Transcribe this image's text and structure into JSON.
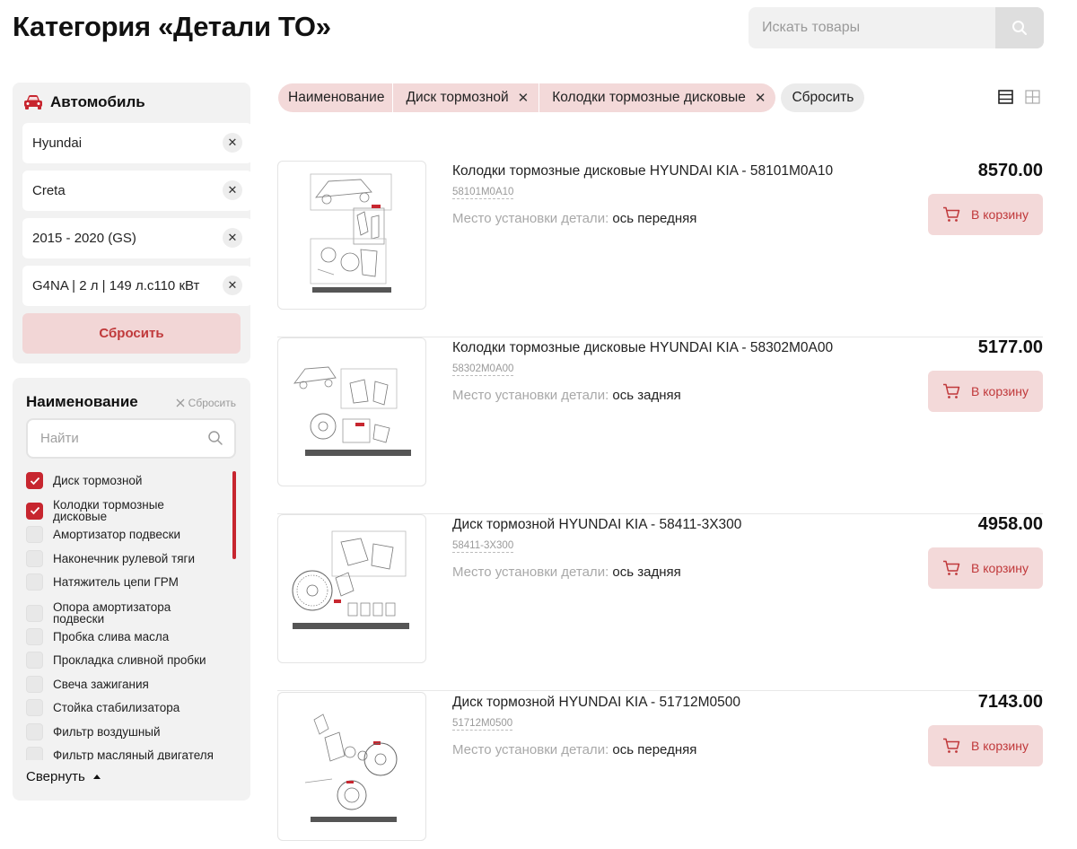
{
  "page": {
    "title": "Категория «Детали ТО»"
  },
  "search": {
    "placeholder": "Искать товары"
  },
  "car": {
    "title": "Автомобиль",
    "fields": [
      "Hyundai",
      "Creta",
      "2015 - 2020 (GS)",
      "G4NA | 2 л | 149 л.с110 кВт"
    ],
    "reset_label": "Сбросить"
  },
  "name_filter": {
    "title": "Наименование",
    "reset_label": "Сбросить",
    "search_placeholder": "Найти",
    "options": [
      {
        "label": "Диск тормозной",
        "checked": true
      },
      {
        "label": "Колодки тормозные дисковые",
        "checked": true
      },
      {
        "label": "Амортизатор подвески",
        "checked": false
      },
      {
        "label": "Наконечник рулевой тяги",
        "checked": false
      },
      {
        "label": "Натяжитель цепи ГРМ",
        "checked": false
      },
      {
        "label": "Опора амортизатора подвески",
        "checked": false
      },
      {
        "label": "Пробка слива масла",
        "checked": false
      },
      {
        "label": "Прокладка сливной пробки",
        "checked": false
      },
      {
        "label": "Свеча зажигания",
        "checked": false
      },
      {
        "label": "Стойка стабилизатора",
        "checked": false
      },
      {
        "label": "Фильтр воздушный",
        "checked": false
      },
      {
        "label": "Фильтр масляный двигателя",
        "checked": false
      }
    ],
    "collapse_label": "Свернуть"
  },
  "chips": {
    "group_label": "Наименование",
    "items": [
      "Диск тормозной",
      "Колодки тормозные дисковые"
    ],
    "reset_label": "Сбросить"
  },
  "products": [
    {
      "title": "Колодки тормозные дисковые HYUNDAI KIA - 58101M0A10",
      "article": "58101M0A10",
      "place_label": "Место установки детали:",
      "place_value": "ось передняя",
      "price": "8570.00",
      "cart_label": "В корзину"
    },
    {
      "title": "Колодки тормозные дисковые HYUNDAI KIA - 58302M0A00",
      "article": "58302M0A00",
      "place_label": "Место установки детали:",
      "place_value": "ось задняя",
      "price": "5177.00",
      "cart_label": "В корзину"
    },
    {
      "title": "Диск тормозной HYUNDAI KIA - 58411-3X300",
      "article": "58411-3X300",
      "place_label": "Место установки детали:",
      "place_value": "ось задняя",
      "price": "4958.00",
      "cart_label": "В корзину"
    },
    {
      "title": "Диск тормозной HYUNDAI KIA - 51712M0500",
      "article": "51712M0500",
      "place_label": "Место установки детали:",
      "place_value": "ось передняя",
      "price": "7143.00",
      "cart_label": "В корзину"
    }
  ],
  "colors": {
    "accent": "#c7262f",
    "accent_soft": "#f3d9d9",
    "panel_bg": "#f2f2f2"
  },
  "icons": {
    "search": "search-icon",
    "car": "car-icon",
    "cart": "cart-icon",
    "list_view": "list-view-icon",
    "grid_view": "grid-view-icon"
  }
}
